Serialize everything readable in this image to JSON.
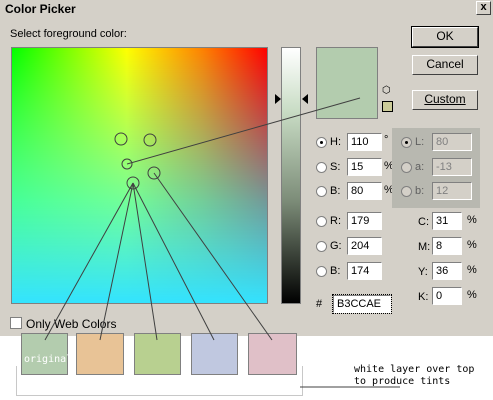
{
  "window": {
    "title": "Color Picker",
    "close_label": "x"
  },
  "picker": {
    "prompt": "Select foreground color:"
  },
  "buttons": {
    "ok": "OK",
    "cancel": "Cancel",
    "custom": "Custom"
  },
  "hsb": {
    "h_label": "H:",
    "h_value": "110",
    "h_unit": "°",
    "s_label": "S:",
    "s_value": "15",
    "s_unit": "%",
    "b_label": "B:",
    "b_value": "80",
    "b_unit": "%"
  },
  "rgb": {
    "r_label": "R:",
    "r_value": "179",
    "g_label": "G:",
    "g_value": "204",
    "b_label": "B:",
    "b_value": "174"
  },
  "lab": {
    "l_label": "L:",
    "l_value": "80",
    "a_label": "a:",
    "a_value": "-13",
    "b_label": "b:",
    "b_value": "12"
  },
  "cmyk": {
    "c_label": "C:",
    "c_value": "31",
    "m_label": "M:",
    "m_value": "8",
    "y_label": "Y:",
    "y_value": "36",
    "k_label": "K:",
    "k_value": "0",
    "unit": "%"
  },
  "hex": {
    "label": "#",
    "value": "B3CCAE"
  },
  "web_colors": {
    "label": "Only Web Colors",
    "checked": false
  },
  "current_color": "#b3ccae",
  "swatches": [
    {
      "label": "original",
      "color": "#b3ccae"
    },
    {
      "label": "",
      "color": "#e8c396"
    },
    {
      "label": "",
      "color": "#b8d090"
    },
    {
      "label": "",
      "color": "#c0c8e0"
    },
    {
      "label": "",
      "color": "#e0c0c8"
    }
  ],
  "annotation": {
    "line1": "white layer over top",
    "line2": "to produce tints"
  }
}
